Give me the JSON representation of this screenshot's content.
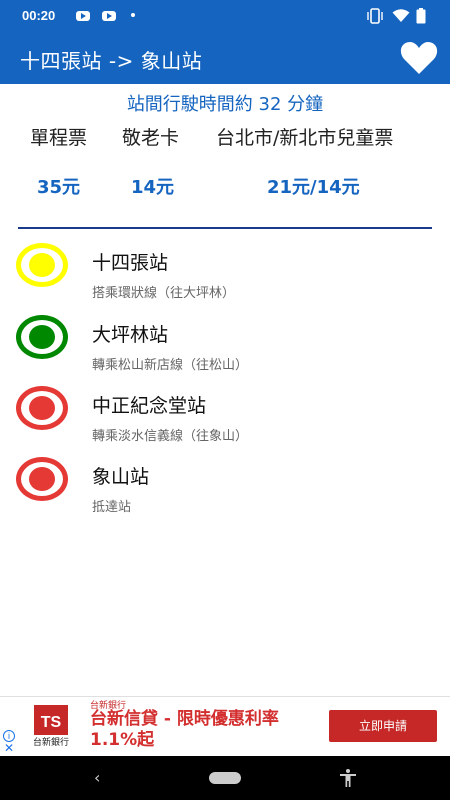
{
  "status_bar": {
    "time": "00:20",
    "icons": [
      "youtube-icon",
      "youtube-icon",
      "dot-icon",
      "vibrate-icon",
      "wifi-icon",
      "battery-icon"
    ]
  },
  "app_bar": {
    "title": "十四張站 -> 象山站",
    "favorite_icon": "heart-icon"
  },
  "travel_time": "站間行駛時間約 32 分鐘",
  "fares": {
    "headers": [
      "單程票",
      "敬老卡",
      "台北市/新北市兒童票"
    ],
    "values": [
      "35元",
      "14元",
      "21元/14元"
    ]
  },
  "route": [
    {
      "name": "十四張站",
      "note": "搭乘環狀線（往大坪林）",
      "color": "#ffff00"
    },
    {
      "name": "大坪林站",
      "note": "轉乘松山新店線（往松山）",
      "color": "#008800"
    },
    {
      "name": "中正紀念堂站",
      "note": "轉乘淡水信義線（往象山）",
      "color": "#e53935"
    },
    {
      "name": "象山站",
      "note": "抵達站",
      "color": "#e53935"
    }
  ],
  "ad": {
    "advertiser": "台新銀行",
    "logo_text": "台新銀行",
    "headline": "台新信貸 - 限時優惠利率1.1%起",
    "cta": "立即申請",
    "info_icon": "info-icon",
    "close_icon": "close-icon"
  },
  "nav_bar": {
    "icons": [
      "back-icon",
      "home-pill-icon",
      "accessibility-icon"
    ]
  }
}
